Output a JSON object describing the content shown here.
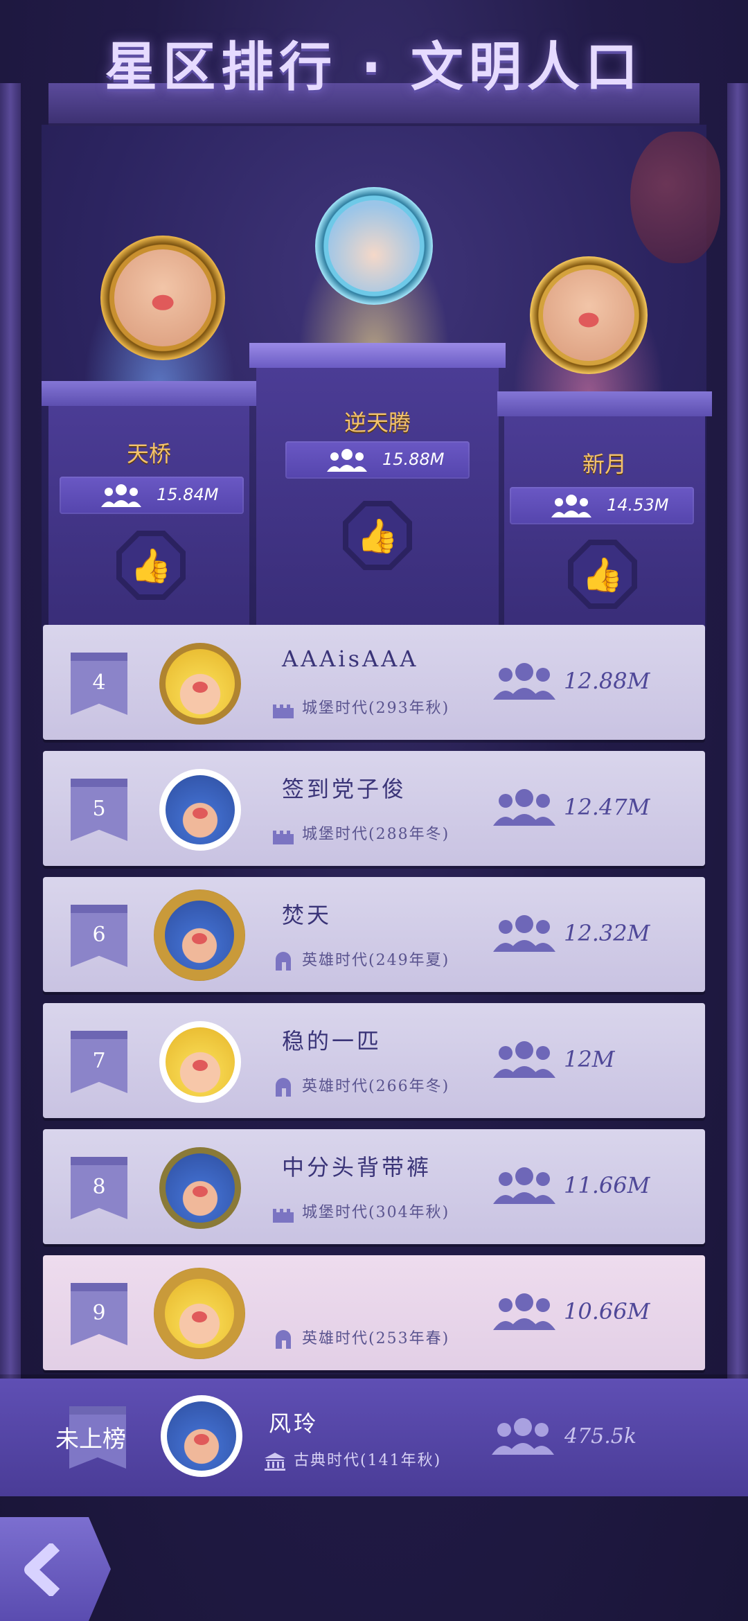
{
  "title": "星区排行 · 文明人口",
  "podium": [
    {
      "rank": 2,
      "name": "天桥",
      "population": "15.84M"
    },
    {
      "rank": 1,
      "name": "逆天腾",
      "population": "15.88M"
    },
    {
      "rank": 3,
      "name": "新月",
      "population": "14.53M"
    }
  ],
  "list": [
    {
      "rank": "4",
      "name": "AAAisAAA",
      "era": "城堡时代(293年秋)",
      "population": "12.88M"
    },
    {
      "rank": "5",
      "name": "签到党子俊",
      "era": "城堡时代(288年冬)",
      "population": "12.47M"
    },
    {
      "rank": "6",
      "name": "焚天",
      "era": "英雄时代(249年夏)",
      "population": "12.32M"
    },
    {
      "rank": "7",
      "name": "稳的一匹",
      "era": "英雄时代(266年冬)",
      "population": "12M"
    },
    {
      "rank": "8",
      "name": "中分头背带裤",
      "era": "城堡时代(304年秋)",
      "population": "11.66M"
    },
    {
      "rank": "9",
      "name": "",
      "era": "英雄时代(253年春)",
      "population": "10.66M"
    }
  ],
  "me": {
    "rank_label": "未上榜",
    "name": "风玲",
    "era": "古典时代(141年秋)",
    "population": "475.5k"
  }
}
